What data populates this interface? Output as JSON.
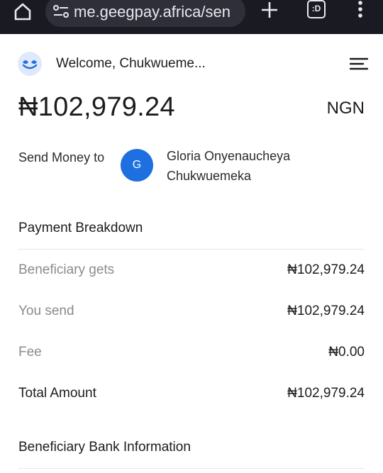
{
  "browser": {
    "url": "me.geegpay.africa/sen",
    "tab_badge": ":D"
  },
  "header": {
    "welcome": "Welcome, Chukwueme..."
  },
  "balance": {
    "amount": "₦102,979.24",
    "currency": "NGN"
  },
  "recipient": {
    "label": "Send Money to",
    "initial": "G",
    "name": "Gloria Onyenaucheya Chukwuemeka"
  },
  "breakdown": {
    "title": "Payment Breakdown",
    "rows": [
      {
        "label": "Beneficiary gets",
        "value": "₦102,979.24"
      },
      {
        "label": "You send",
        "value": "₦102,979.24"
      },
      {
        "label": "Fee",
        "value": "₦0.00"
      },
      {
        "label": "Total Amount",
        "value": "₦102,979.24"
      }
    ]
  },
  "bank_info": {
    "title": "Beneficiary Bank Information"
  },
  "colors": {
    "chrome_bg": "#1a1b22",
    "avatar_blue": "#1e6fe0",
    "muted_text": "#8b8b90"
  },
  "icons": [
    "home-icon",
    "site-settings-icon",
    "new-tab-icon",
    "tab-switcher-icon",
    "more-options-icon",
    "geegpay-logo",
    "hamburger-menu-icon"
  ]
}
